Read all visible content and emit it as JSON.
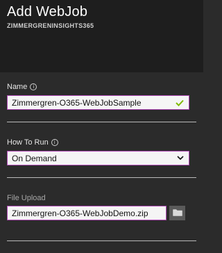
{
  "header": {
    "title": "Add WebJob",
    "subtitle": "ZIMMERGRENINSIGHTS365"
  },
  "name_field": {
    "label": "Name",
    "value": "Zimmergren-O365-WebJobSample",
    "valid": true
  },
  "how_to_run": {
    "label": "How To Run",
    "selected": "On Demand"
  },
  "file_upload": {
    "label": "File Upload",
    "value": "Zimmergren-O365-WebJobDemo.zip"
  },
  "icons": {
    "info": "info-icon",
    "check": "checkmark-icon",
    "chevron": "chevron-down-icon",
    "folder": "folder-icon"
  },
  "colors": {
    "accent_border": "#b04bb6",
    "valid_check": "#7fba00",
    "header_bg": "#1e1e1e",
    "panel_bg": "#2b2b2b"
  }
}
